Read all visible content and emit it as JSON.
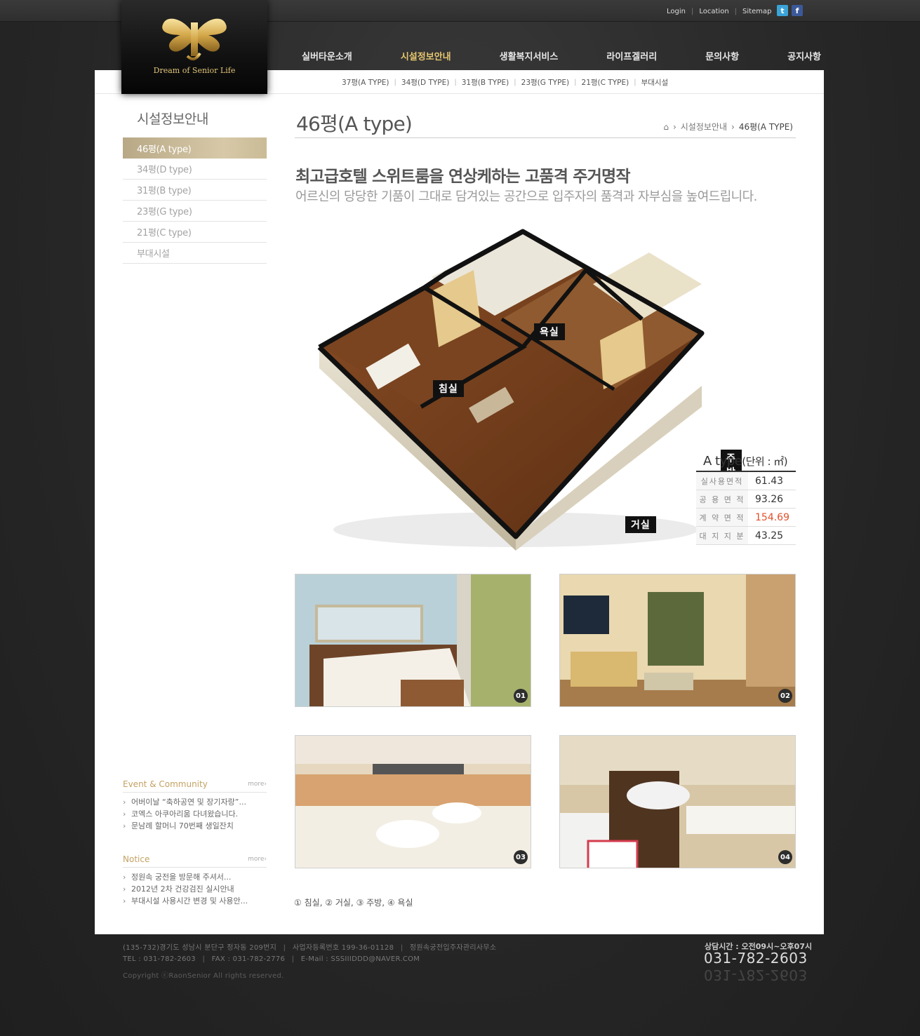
{
  "util": {
    "login": "Login",
    "location": "Location",
    "sitemap": "Sitemap"
  },
  "logo": {
    "text": "Dream of Senior Life"
  },
  "gnb": [
    "실버타운소개",
    "시설정보안내",
    "생활복지서비스",
    "라이프겔러리",
    "문의사항",
    "공지사항"
  ],
  "lnb": [
    "37평(A TYPE)",
    "34평(D TYPE)",
    "31평(B TYPE)",
    "23평(G TYPE)",
    "21평(C TYPE)",
    "부대시설"
  ],
  "side": {
    "title": "시설정보안내",
    "items": [
      "46평(A type)",
      "34평(D type)",
      "31평(B type)",
      "23평(G type)",
      "21평(C type)",
      "부대시설"
    ]
  },
  "event": {
    "title": "Event & Community",
    "more": "more›",
    "items": [
      "어버이날 “축하공연 및 장기자랑”...",
      "코엑스 아쿠아리움 다녀왔습니다.",
      "문남례 할머니 70번째 생일잔치"
    ]
  },
  "notice": {
    "title": "Notice",
    "more": "more›",
    "items": [
      "정원속 궁전을 방문해 주셔서...",
      "2012년 2차 건강검진 실시안내",
      "부대시설 사용시간 변경 및 사용안..."
    ]
  },
  "content": {
    "title": "46평(A type)",
    "breadcrumb": [
      "시설정보안내",
      "46평(A TYPE)"
    ],
    "headline": "최고급호텔 스위트룸을 연상케하는 고품격 주거명작",
    "subline": "어르신의 당당한 기품이 그대로 담겨있는 공간으로 입주자의 품격과 자부심을 높여드립니다.",
    "plan_labels": {
      "bath": "욕실",
      "bed": "침실",
      "kitchen": "주방",
      "living": "거실"
    },
    "area": {
      "title": "A type",
      "unit": "(단위 : ㎡)",
      "rows": [
        {
          "k": "실사용면적",
          "v": "61.43"
        },
        {
          "k": "공 용 면 적",
          "v": "93.26"
        },
        {
          "k": "계 약 면 적",
          "v": "154.69"
        },
        {
          "k": "대 지 지 분",
          "v": "43.25"
        }
      ]
    },
    "photos": [
      "01",
      "02",
      "03",
      "04"
    ],
    "caption": "① 침실, ② 거실, ③ 주방, ④ 욕실"
  },
  "footer": {
    "address": "(135-732)경기도 성남시 분단구 정자동 209번지",
    "bizno": "사업자등록번호 199-36-01128",
    "office": "정원속궁전입주자관리사무소",
    "tel": "TEL : 031-782-2603",
    "fax": "FAX : 031-782-2776",
    "email": "E-Mail : SSSIIIDDD@NAVER.COM",
    "copyright": "Copyright ⓒRaonSenior All rights reserved.",
    "hours": "상담시간 : 오전09시~오후07시",
    "phone": "031-782-2603"
  },
  "colors": {
    "gold": "#e6c66f",
    "accent_red": "#e1502a",
    "active_side": "#c5b791"
  }
}
